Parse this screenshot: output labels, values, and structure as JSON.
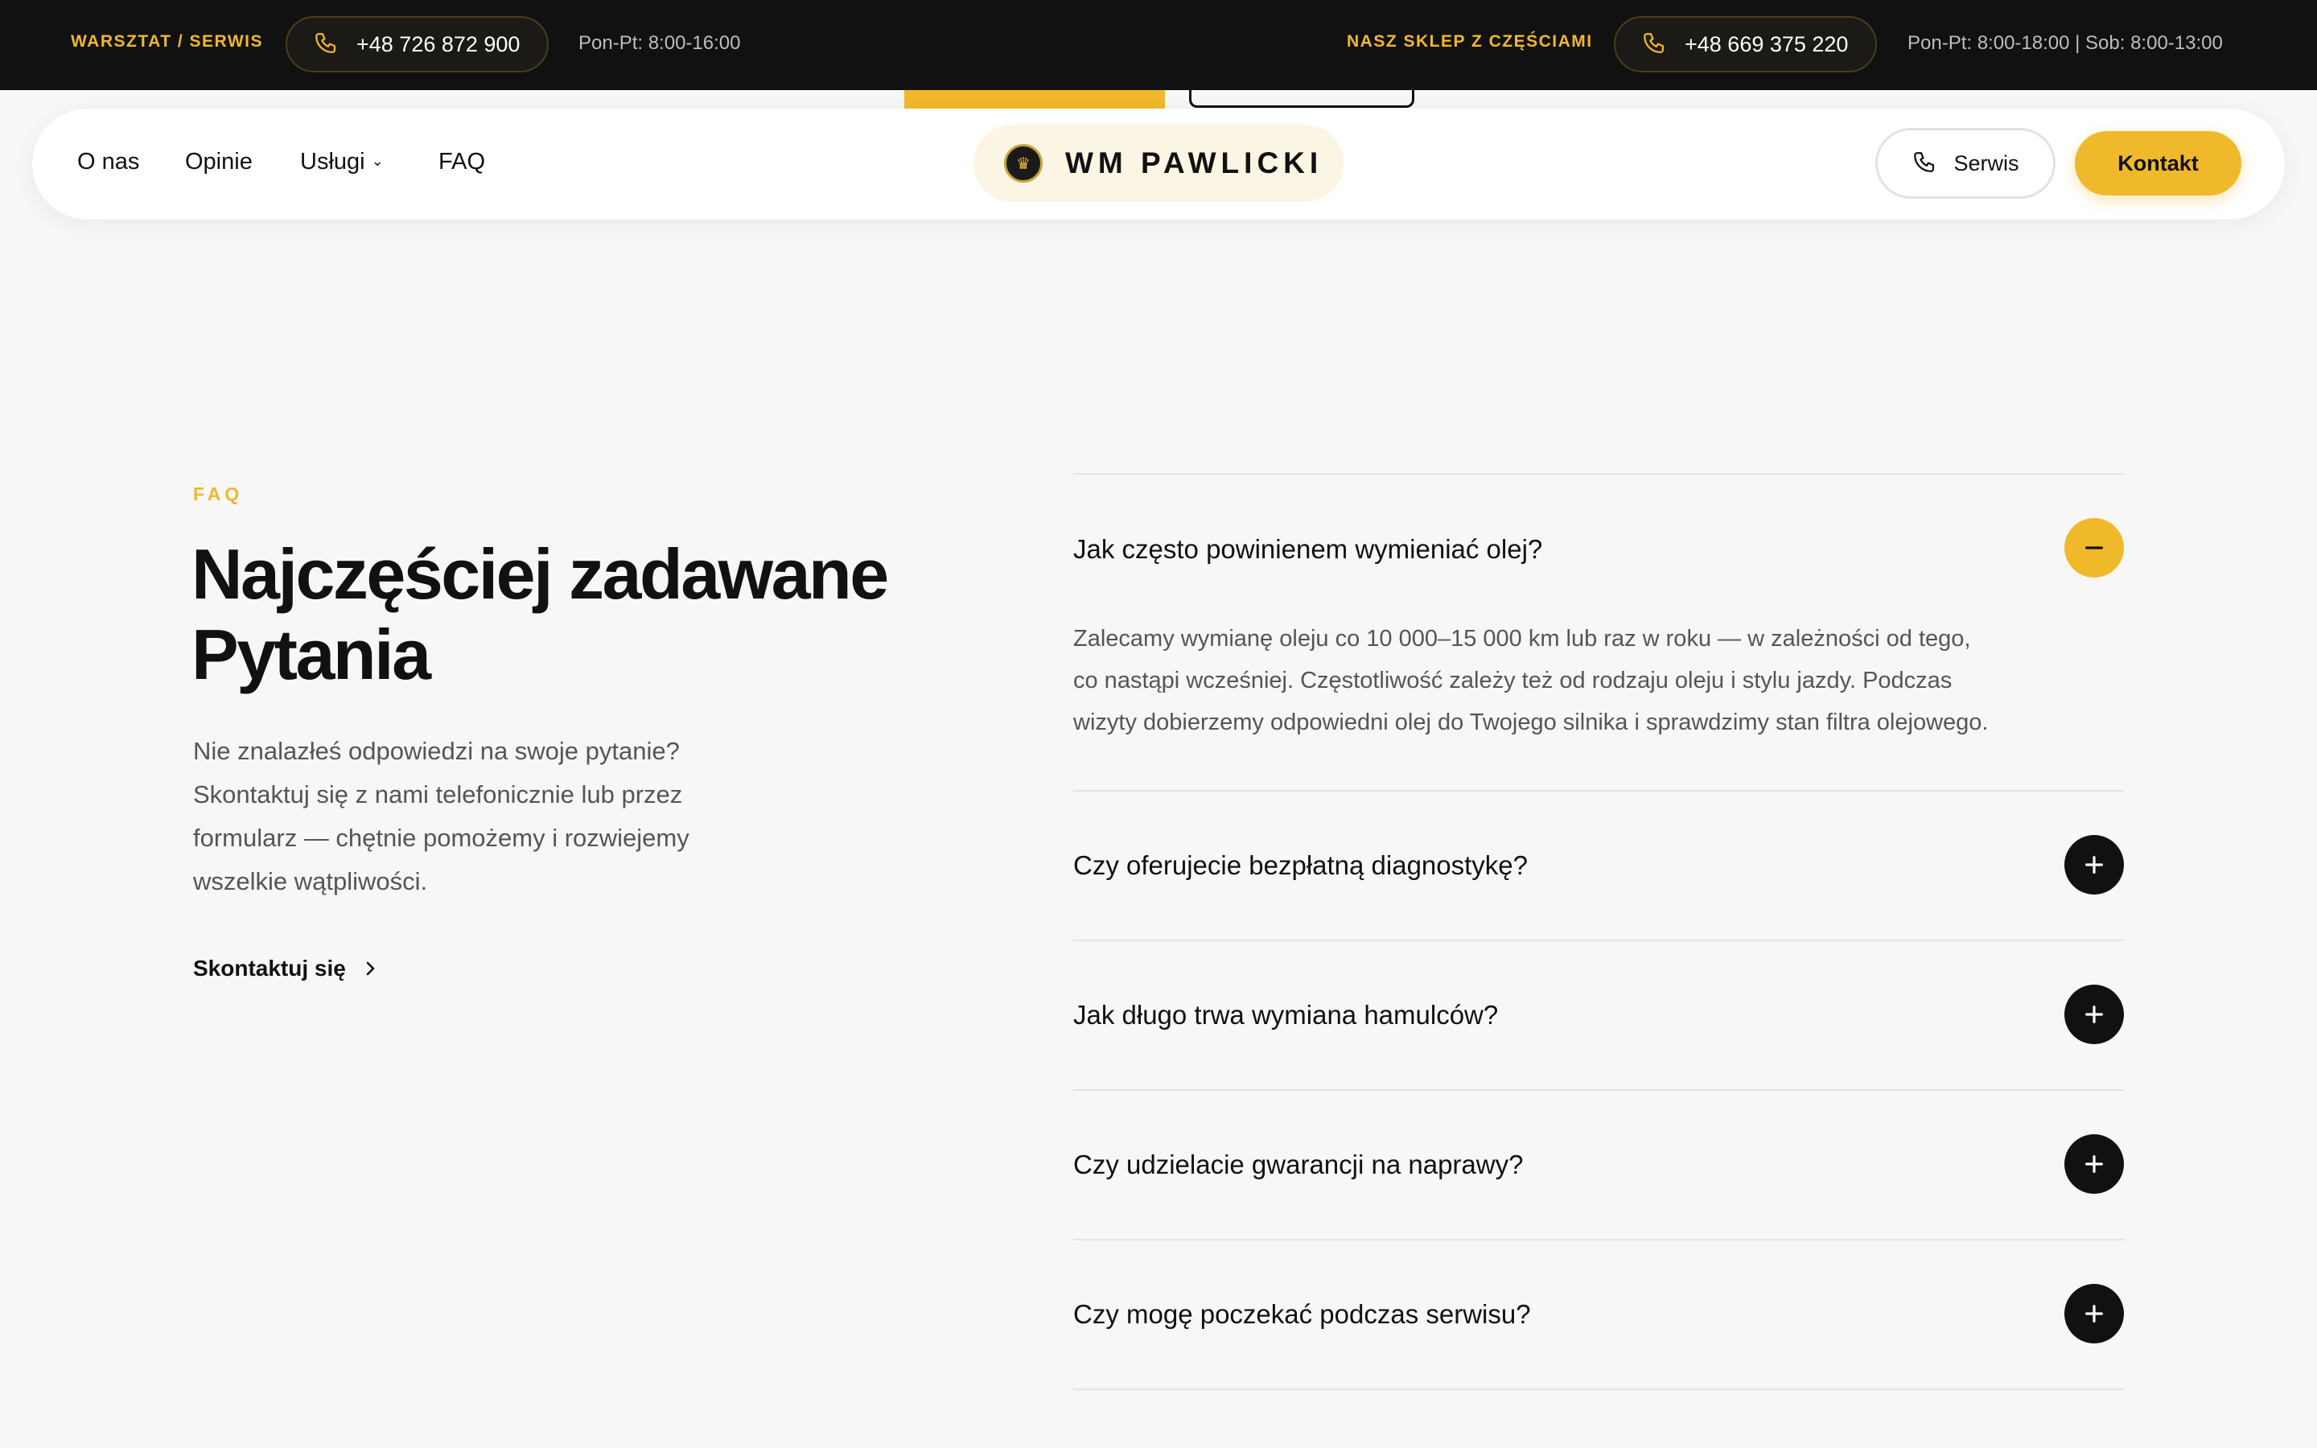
{
  "topbar": {
    "left_label": "WARSZTAT / SERWIS",
    "left_phone": "+48 726 872 900",
    "left_hours": "Pon-Pt: 8:00-16:00",
    "right_label": "NASZ SKLEP Z CZĘŚCIAMI",
    "right_phone": "+48 669 375 220",
    "right_hours": "Pon-Pt: 8:00-18:00 | Sob: 8:00-13:00"
  },
  "nav": {
    "links": [
      {
        "label": "O nas"
      },
      {
        "label": "Opinie"
      },
      {
        "label": "Usługi"
      },
      {
        "label": "FAQ"
      }
    ],
    "logo_text": "WM PAWLICKI",
    "serwis_label": "Serwis",
    "kontakt_label": "Kontakt"
  },
  "faq": {
    "eyebrow": "FAQ",
    "title": "Najczęściej zadawane Pytania",
    "lead": "Nie znalazłeś odpowiedzi na swoje pytanie? Skontaktuj się z nami telefonicznie lub przez formularz — chętnie pomożemy i rozwiejemy wszelkie wątpliwości.",
    "contact_link": "Skontaktuj się",
    "items": [
      {
        "question": "Jak często powinienem wymieniać olej?",
        "answer": "Zalecamy wymianę oleju co 10 000–15 000 km lub raz w roku — w zależności od tego, co nastąpi wcześniej. Częstotliwość zależy też od rodzaju oleju i stylu jazdy. Podczas wizyty dobierzemy odpowiedni olej do Twojego silnika i sprawdzimy stan filtra olejowego.",
        "expanded": true
      },
      {
        "question": "Czy oferujecie bezpłatną diagnostykę?",
        "expanded": false
      },
      {
        "question": "Jak długo trwa wymiana hamulców?",
        "expanded": false
      },
      {
        "question": "Czy udzielacie gwarancji na naprawy?",
        "expanded": false
      },
      {
        "question": "Czy mogę poczekać podczas serwisu?",
        "expanded": false
      }
    ]
  },
  "colors": {
    "accent": "#f0b82b",
    "dark": "#111111",
    "background": "#f7f7f7",
    "muted_text": "#555555"
  },
  "icons": {
    "phone": "phone-icon",
    "chevron_down": "chevron-down-icon",
    "chevron_right": "chevron-right-icon",
    "plus": "plus-icon",
    "minus": "minus-icon",
    "crown": "crown-icon"
  }
}
